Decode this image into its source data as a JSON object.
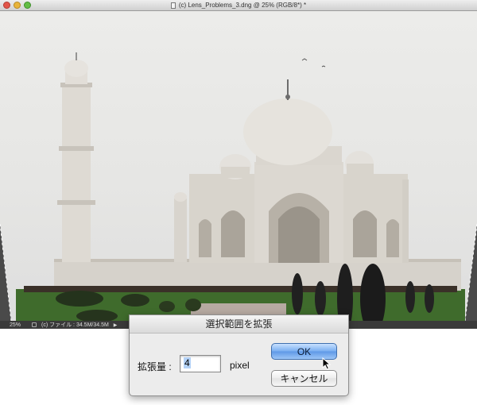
{
  "window": {
    "title": "(c) Lens_Problems_3.dng @ 25% (RGB/8*) *"
  },
  "statusbar": {
    "zoom": "25%",
    "info": "(c) ファイル : 34.5M/34.5M",
    "arrow": "▶"
  },
  "dialog": {
    "title": "選択範囲を拡張",
    "amount_label": "拡張量 :",
    "amount_value": "4",
    "unit": "pixel",
    "ok_label": "OK",
    "cancel_label": "キャンセル"
  },
  "colors": {
    "ok_button": "#6fa6ee",
    "sky": "#e8e8e6",
    "marble": "#d4d0c8",
    "grass": "#3f6b2c"
  },
  "icons": {
    "close": "close-icon",
    "minimize": "minimize-icon",
    "maximize": "maximize-icon",
    "document": "document-icon",
    "cursor": "pointer-cursor-icon"
  }
}
